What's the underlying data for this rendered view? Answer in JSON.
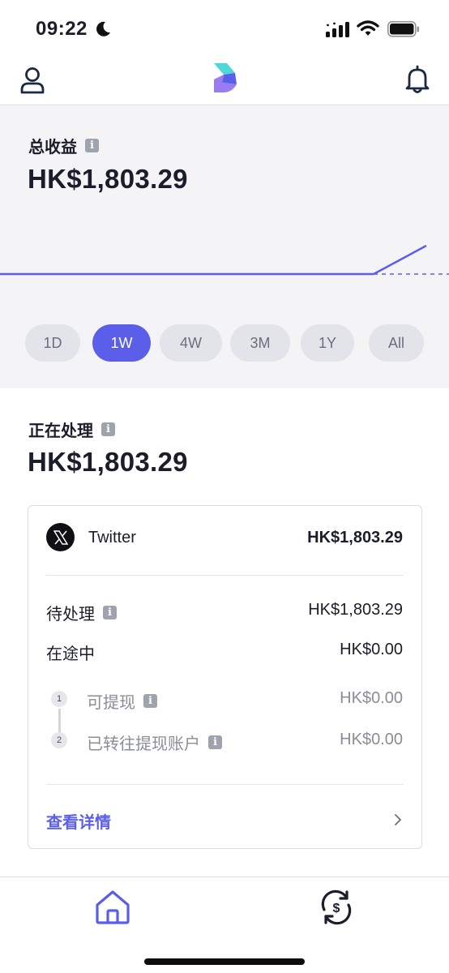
{
  "status_bar": {
    "time": "09:22",
    "icons": [
      "moon-icon",
      "signal-icon",
      "wifi-icon",
      "battery-icon"
    ]
  },
  "nav": {
    "left_icon": "profile-icon",
    "center_logo": "app-logo",
    "right_icon": "bell-icon"
  },
  "total_earnings": {
    "label": "总收益",
    "amount": "HK$1,803.29"
  },
  "range_tabs": [
    {
      "label": "1D",
      "active": false
    },
    {
      "label": "1W",
      "active": true
    },
    {
      "label": "4W",
      "active": false
    },
    {
      "label": "3M",
      "active": false
    },
    {
      "label": "1Y",
      "active": false
    },
    {
      "label": "All",
      "active": false
    }
  ],
  "processing": {
    "label": "正在处理",
    "amount": "HK$1,803.29"
  },
  "card": {
    "platform_name": "Twitter",
    "platform_amount": "HK$1,803.29",
    "pending_label": "待处理",
    "pending_value": "HK$1,803.29",
    "in_transit_label": "在途中",
    "in_transit_value": "HK$0.00",
    "steps": [
      {
        "number": "1",
        "label": "可提现",
        "value": "HK$0.00"
      },
      {
        "number": "2",
        "label": "已转往提现账户",
        "value": "HK$0.00"
      }
    ],
    "details_link": "查看详情"
  },
  "bottom_nav": {
    "items": [
      "home-icon",
      "exchange-icon"
    ]
  },
  "colors": {
    "accent": "#5b5ee8",
    "panel_bg": "#f4f4f7",
    "text": "#1c1d2b",
    "muted": "#8a8d98"
  }
}
